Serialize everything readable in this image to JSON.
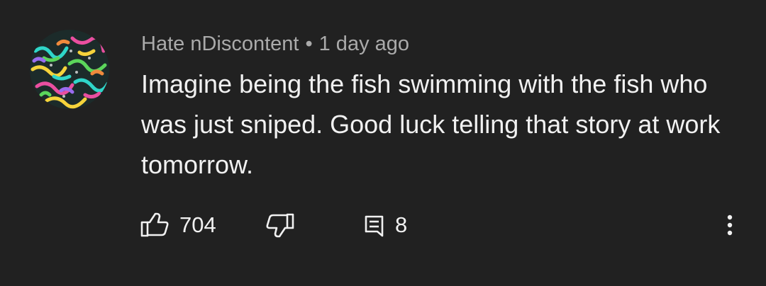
{
  "comment": {
    "author": "Hate nDiscontent",
    "separator": "•",
    "time": "1 day ago",
    "text": "Imagine being the fish swimming with the fish who was just sniped. Good luck telling that story at work tomorrow.",
    "likes": "704",
    "replies": "8"
  },
  "icons": {
    "like": "thumb-up-icon",
    "dislike": "thumb-down-icon",
    "reply": "reply-comment-icon",
    "menu": "more-vertical-icon"
  },
  "colors": {
    "background": "#212121",
    "text": "#f1f1f1",
    "meta": "#aaaaaa"
  }
}
